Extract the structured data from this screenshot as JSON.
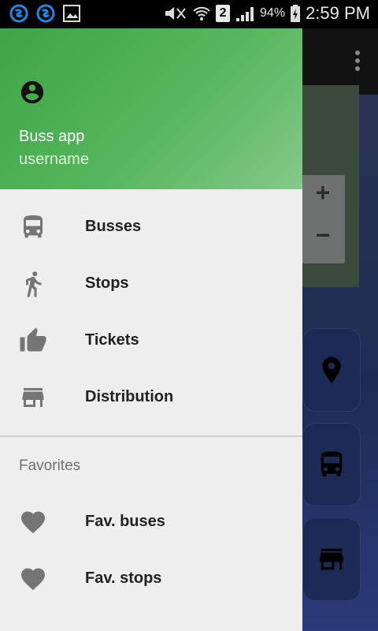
{
  "status_bar": {
    "sim_number": "2",
    "battery": "94%",
    "time": "2:59 PM"
  },
  "header": {
    "app_name": "Buss app",
    "username": "username"
  },
  "menu": [
    {
      "label": "Busses",
      "icon": "bus-icon"
    },
    {
      "label": "Stops",
      "icon": "walk-icon"
    },
    {
      "label": "Tickets",
      "icon": "ticket-icon"
    },
    {
      "label": "Distribution",
      "icon": "store-icon"
    }
  ],
  "favorites": {
    "title": "Favorites",
    "items": [
      {
        "label": "Fav. buses",
        "icon": "heart-icon"
      },
      {
        "label": "Fav. stops",
        "icon": "heart-icon"
      }
    ]
  },
  "colors": {
    "header_green": "#4caf50",
    "drawer_bg": "#eeeeee",
    "icon_gray": "#757575"
  }
}
